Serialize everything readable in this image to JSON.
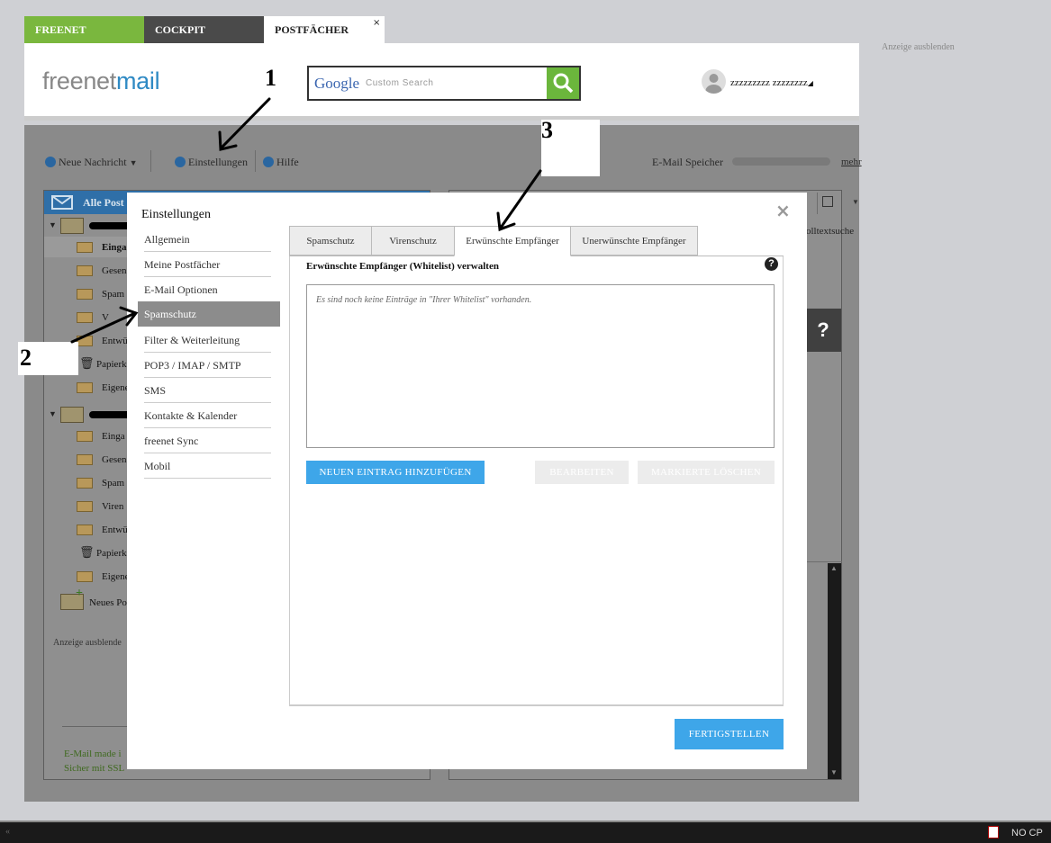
{
  "top_tabs": {
    "freenet": "FREENET",
    "cockpit": "COCKPIT",
    "postfaecher": "POSTFÄCHER",
    "close": "×"
  },
  "header": {
    "logo_a": "freenet",
    "logo_b": "mail",
    "search_brand": "Google",
    "search_placeholder": "Custom Search",
    "username": "zzzzzzzzz zzzzzzzz"
  },
  "ad_hide": "Anzeige ausblenden",
  "toolbar": {
    "new_message": "Neue Nachricht",
    "settings": "Einstellungen",
    "help": "Hilfe",
    "storage": "E-Mail Speicher",
    "more": "mehr"
  },
  "mailbox_panel": {
    "header": "Alle Post",
    "account1_folders": [
      "Einga",
      "Gesen",
      "Spam",
      "V",
      "Entwü",
      "Papierk",
      "Eigene"
    ],
    "account2_folders": [
      "Einga",
      "Gesen",
      "Spam",
      "Viren",
      "Entwü",
      "Papierk",
      "Eigene"
    ],
    "new_mailbox": "Neues Po",
    "ad_hide": "Anzeige ausblende",
    "footer1": "E-Mail made i",
    "footer2": "Sicher mit SSL"
  },
  "right_panel": {
    "fulltext": "olltextsuche"
  },
  "help_box": "?",
  "modal": {
    "title": "Einstellungen",
    "close": "×",
    "nav": [
      {
        "label": "Allgemein"
      },
      {
        "label": "Meine Postfächer"
      },
      {
        "label": "E-Mail Optionen"
      },
      {
        "label": "Spamschutz"
      },
      {
        "label": "Filter & Weiterleitung"
      },
      {
        "label": "POP3 / IMAP / SMTP"
      },
      {
        "label": "SMS"
      },
      {
        "label": "Kontakte & Kalender"
      },
      {
        "label": "freenet Sync"
      },
      {
        "label": "Mobil"
      }
    ],
    "tabs": [
      {
        "label": "Spamschutz"
      },
      {
        "label": "Virenschutz"
      },
      {
        "label": "Erwünschte Empfänger"
      },
      {
        "label": "Unerwünschte Empfänger"
      }
    ],
    "section_title": "Erwünschte Empfänger (Whitelist) verwalten",
    "section_help": "?",
    "empty_text": "Es sind noch keine Einträge in \"Ihrer Whitelist\" vorhanden.",
    "btn_new": "NEUEN EINTRAG HINZUFÜGEN",
    "btn_edit": "BEARBEITEN",
    "btn_delete": "MARKIERTE LÖSCHEN",
    "btn_done": "FERTIGSTELLEN"
  },
  "annotations": [
    "1",
    "2",
    "3"
  ],
  "statusbar": {
    "nocp": "NO CP"
  },
  "colors": {
    "freenet_green": "#7ab73e",
    "brand_blue": "#2f8ac4",
    "button_blue": "#3ea6e9"
  }
}
